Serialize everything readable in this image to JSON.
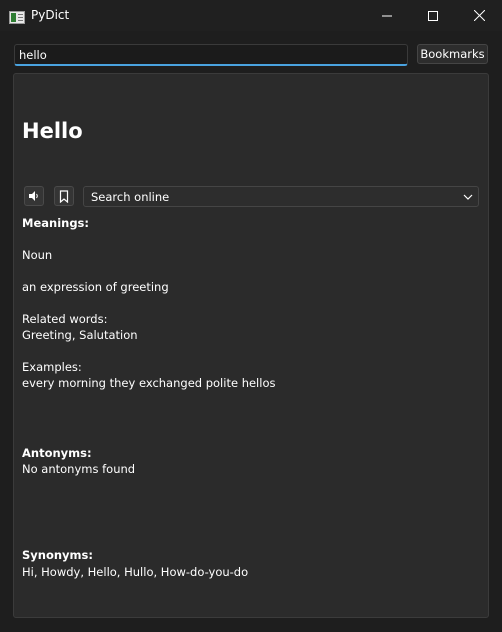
{
  "window": {
    "title": "PyDict"
  },
  "search": {
    "value": "hello",
    "placeholder": ""
  },
  "toolbar": {
    "bookmarks_label": "Bookmarks"
  },
  "entry": {
    "word": "Hello",
    "online_select": {
      "selected": "Search online"
    },
    "meanings_heading": "Meanings:",
    "part_of_speech": "Noun",
    "definition": "an expression of greeting",
    "related_heading": "Related words:",
    "related_words": "Greeting, Salutation",
    "examples_heading": "Examples:",
    "example": "every morning they exchanged polite hellos",
    "antonyms_heading": "Antonyms:",
    "antonyms": "No antonyms found",
    "synonyms_heading": "Synonyms:",
    "synonyms": "Hi, Howdy, Hello, Hullo, How-do-you-do"
  },
  "icons": {
    "app": "dictionary-app-icon",
    "speaker": "speaker-icon",
    "bookmark": "bookmark-icon",
    "chevron": "chevron-down-icon"
  },
  "colors": {
    "background": "#202020",
    "panel": "#2b2b2b",
    "accent": "#4aa3e0",
    "text": "#ffffff"
  }
}
